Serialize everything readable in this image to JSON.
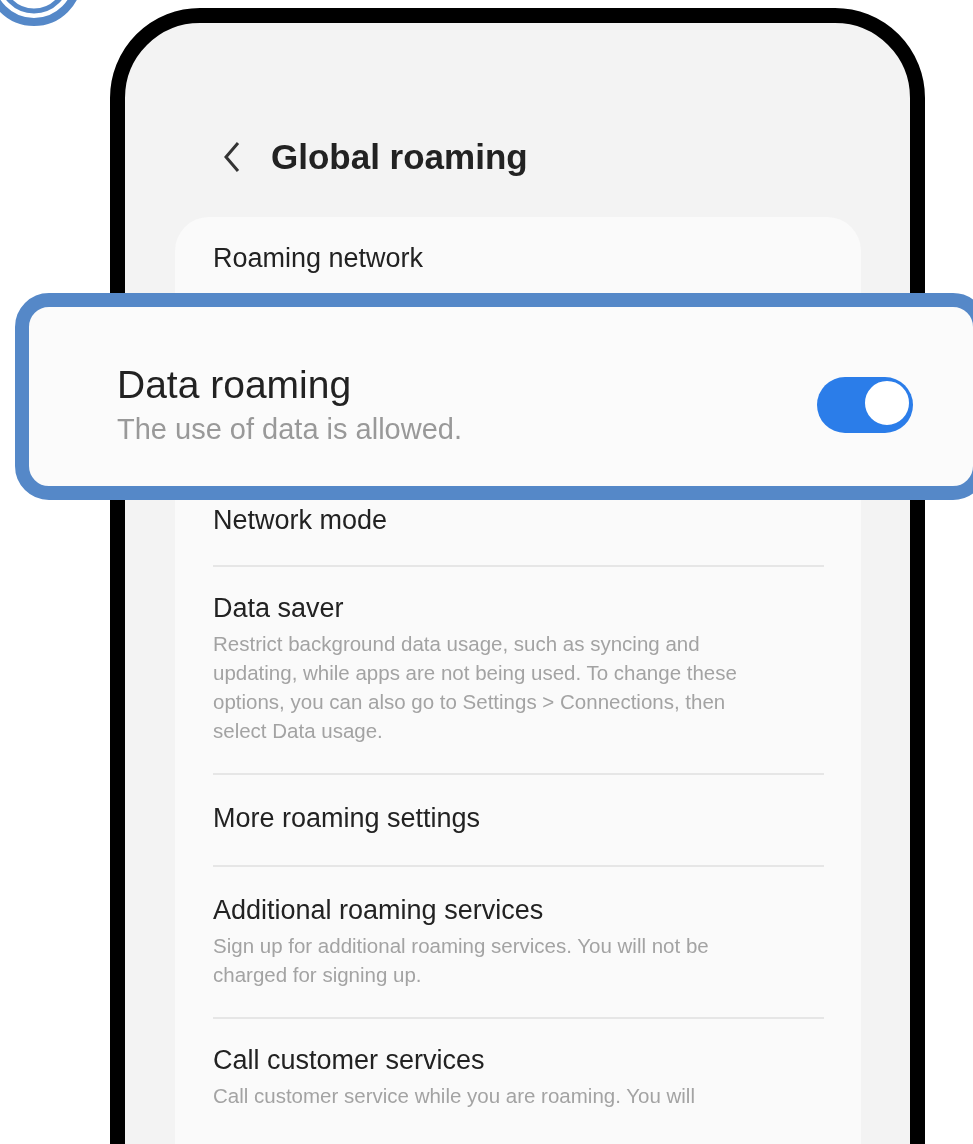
{
  "header": {
    "title": "Global roaming"
  },
  "settings": [
    {
      "kind": "plain",
      "title": "Roaming network"
    },
    {
      "kind": "plain",
      "title": "Network mode"
    },
    {
      "kind": "described",
      "title": "Data saver",
      "description": "Restrict background data usage, such as syncing and updating, while apps are not being used. To change these options, you can also go to Settings > Connections, then select Data usage."
    },
    {
      "kind": "plain",
      "title": "More roaming settings"
    },
    {
      "kind": "described",
      "title": "Additional roaming services",
      "description": "Sign up for additional roaming services. You will not be charged for signing up."
    },
    {
      "kind": "described",
      "title": "Call customer services",
      "description": "Call customer service while you are roaming. You will"
    }
  ],
  "highlight": {
    "title": "Data roaming",
    "description": "The use of data is allowed.",
    "on": true
  }
}
